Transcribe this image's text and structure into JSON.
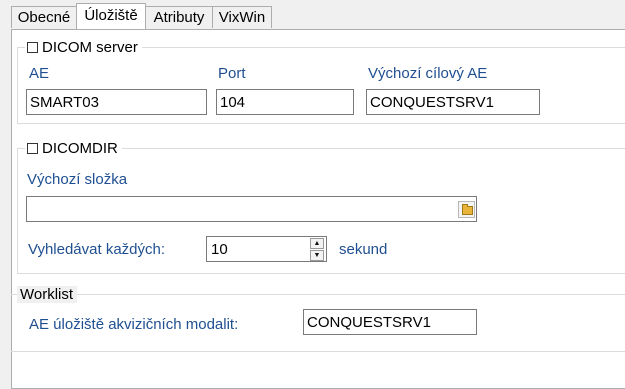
{
  "tabs": [
    {
      "label": "Obecné"
    },
    {
      "label": "Úložiště"
    },
    {
      "label": "Atributy"
    },
    {
      "label": "VixWin"
    }
  ],
  "dicom_server": {
    "title": "DICOM server",
    "ae_label": "AE",
    "ae_value": "SMART03",
    "port_label": "Port",
    "port_value": "104",
    "target_label": "Výchozí cílový AE",
    "target_value": "CONQUESTSRV1"
  },
  "dicomdir": {
    "title": "DICOMDIR",
    "folder_label": "Výchozí složka",
    "folder_value": "",
    "scan_label": "Vyhledávat každých:",
    "scan_value": "10",
    "scan_unit": "sekund"
  },
  "worklist": {
    "title": "Worklist",
    "ae_label": "AE úložiště akvizičních modalit:",
    "ae_value": "CONQUESTSRV1"
  }
}
